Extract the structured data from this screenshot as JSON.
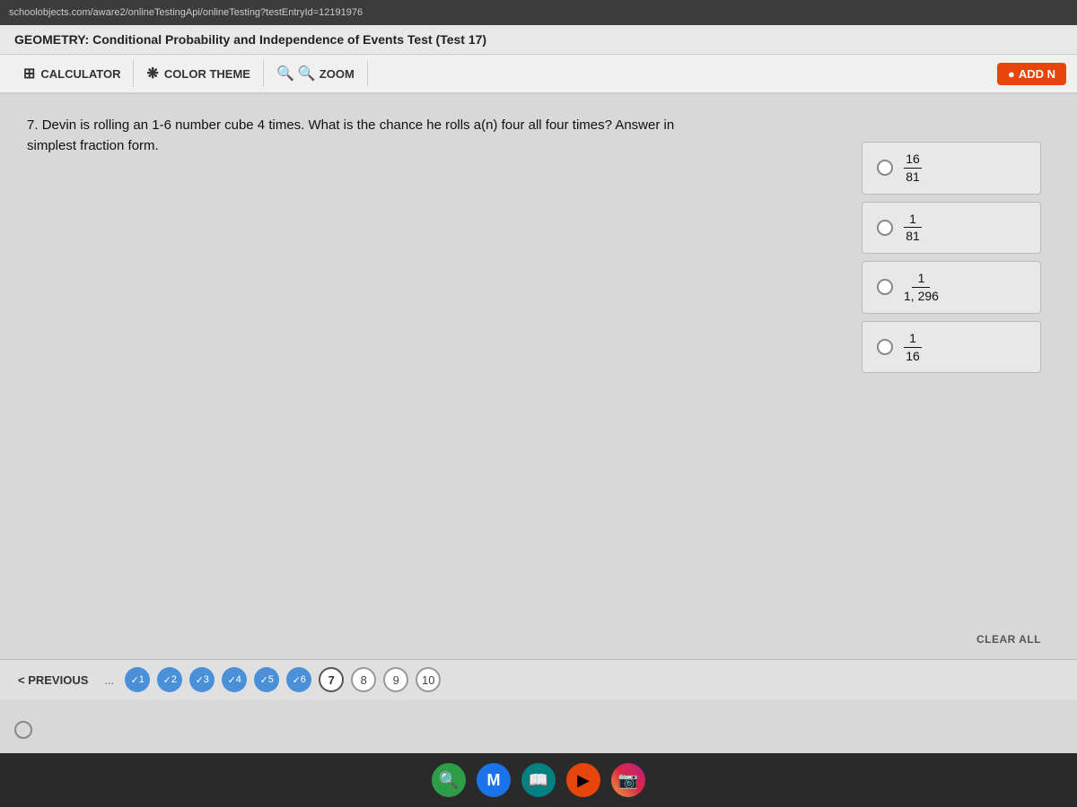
{
  "browser": {
    "url": "schoolobjects.com/aware2/onlineTestingApi/onlineTesting?testEntryId=12191976"
  },
  "title": "GEOMETRY: Conditional Probability and Independence of Events Test (Test 17)",
  "toolbar": {
    "calculator_label": "CALCULATOR",
    "color_theme_label": "COLOR THEME",
    "zoom_label": "ZOOM",
    "add_note_label": "ADD N"
  },
  "question": {
    "number": "7.",
    "text": "Devin is rolling an 1-6 number cube 4 times. What is the chance he rolls a(n) four all four times? Answer in simplest fraction form."
  },
  "choices": [
    {
      "id": "A",
      "numerator": "16",
      "denominator": "81"
    },
    {
      "id": "B",
      "numerator": "1",
      "denominator": "81"
    },
    {
      "id": "C",
      "numerator": "1",
      "denominator": "1, 296"
    },
    {
      "id": "D",
      "numerator": "1",
      "denominator": "16"
    }
  ],
  "clear_all_label": "CLEAR ALL",
  "navigation": {
    "previous_label": "< PREVIOUS",
    "ellipsis": "...",
    "pages": [
      {
        "num": "1",
        "state": "completed"
      },
      {
        "num": "2",
        "state": "completed"
      },
      {
        "num": "3",
        "state": "completed"
      },
      {
        "num": "4",
        "state": "completed"
      },
      {
        "num": "5",
        "state": "completed"
      },
      {
        "num": "6",
        "state": "completed"
      },
      {
        "num": "7",
        "state": "current"
      },
      {
        "num": "8",
        "state": "empty"
      },
      {
        "num": "9",
        "state": "empty"
      },
      {
        "num": "10",
        "state": "empty"
      }
    ]
  },
  "taskbar": {
    "icons": [
      "🔍",
      "M",
      "📖",
      "▶",
      "📷"
    ]
  }
}
